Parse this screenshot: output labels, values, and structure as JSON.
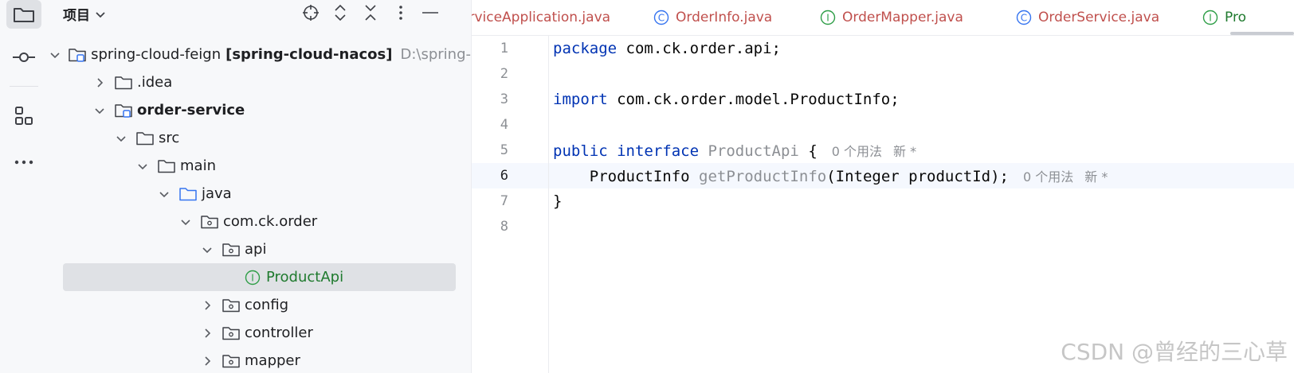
{
  "toolstrip": {
    "items": [
      {
        "icon": "folder-icon",
        "active": true
      },
      {
        "icon": "commit-icon",
        "active": false
      },
      {
        "icon": "structure-icon",
        "active": false
      },
      {
        "icon": "more-icon",
        "active": false
      }
    ]
  },
  "project_panel": {
    "title": "项目",
    "actions": [
      "locate-icon",
      "expand-all-icon",
      "collapse-all-icon",
      "options-icon",
      "hide-icon"
    ],
    "tree": [
      {
        "label": "spring-cloud-feign",
        "extra_bold": "[spring-cloud-nacos]",
        "path_hint": "D:\\spring-",
        "depth": 0,
        "expanded": true,
        "icon": "module-folder-icon"
      },
      {
        "label": ".idea",
        "depth": 1,
        "expanded": false,
        "icon": "folder-icon"
      },
      {
        "label": "order-service",
        "depth": 1,
        "expanded": true,
        "icon": "module-folder-icon",
        "bold": true
      },
      {
        "label": "src",
        "depth": 2,
        "expanded": true,
        "icon": "folder-icon"
      },
      {
        "label": "main",
        "depth": 3,
        "expanded": true,
        "icon": "folder-icon"
      },
      {
        "label": "java",
        "depth": 4,
        "expanded": true,
        "icon": "source-folder-icon"
      },
      {
        "label": "com.ck.order",
        "depth": 5,
        "expanded": true,
        "icon": "package-icon"
      },
      {
        "label": "api",
        "depth": 6,
        "expanded": true,
        "icon": "package-icon"
      },
      {
        "label": "ProductApi",
        "depth": 7,
        "leaf": true,
        "icon": "interface-icon",
        "selected": true
      },
      {
        "label": "config",
        "depth": 6,
        "expanded": false,
        "icon": "package-icon"
      },
      {
        "label": "controller",
        "depth": 6,
        "expanded": false,
        "icon": "package-icon"
      },
      {
        "label": "mapper",
        "depth": 6,
        "expanded": false,
        "icon": "package-icon"
      }
    ]
  },
  "editor": {
    "tabs": [
      {
        "label": "erviceApplication.java",
        "icon": "none"
      },
      {
        "label": "OrderInfo.java",
        "icon": "class-icon"
      },
      {
        "label": "OrderMapper.java",
        "icon": "interface-icon"
      },
      {
        "label": "OrderService.java",
        "icon": "class-icon"
      },
      {
        "label": "Pro",
        "icon": "interface-icon"
      }
    ],
    "current_line": 6,
    "lines": [
      {
        "num": "1",
        "kw": "package",
        "rest": " com.ck.order.api;"
      },
      {
        "num": "2"
      },
      {
        "num": "3",
        "kw": "import",
        "rest": " com.ck.order.model.ProductInfo;"
      },
      {
        "num": "4"
      },
      {
        "num": "5",
        "kw": "public interface",
        "name": "ProductApi",
        "rest": " {",
        "hint": "0 个用法",
        "hint_new": "新 *"
      },
      {
        "num": "6",
        "indent": "    ",
        "type": "ProductInfo ",
        "name": "getProductInfo",
        "rest": "(Integer productId);",
        "hint": "0 个用法",
        "hint_new": "新 *"
      },
      {
        "num": "7",
        "rest": "}"
      },
      {
        "num": "8"
      }
    ]
  },
  "watermark": "CSDN @曾经的三心草",
  "colors": {
    "keyword": "#0033b3",
    "interface_green": "#1f7a2e",
    "tab_text": "#c0504d",
    "hint": "#8c8f94",
    "selection": "#dfe1e5"
  }
}
